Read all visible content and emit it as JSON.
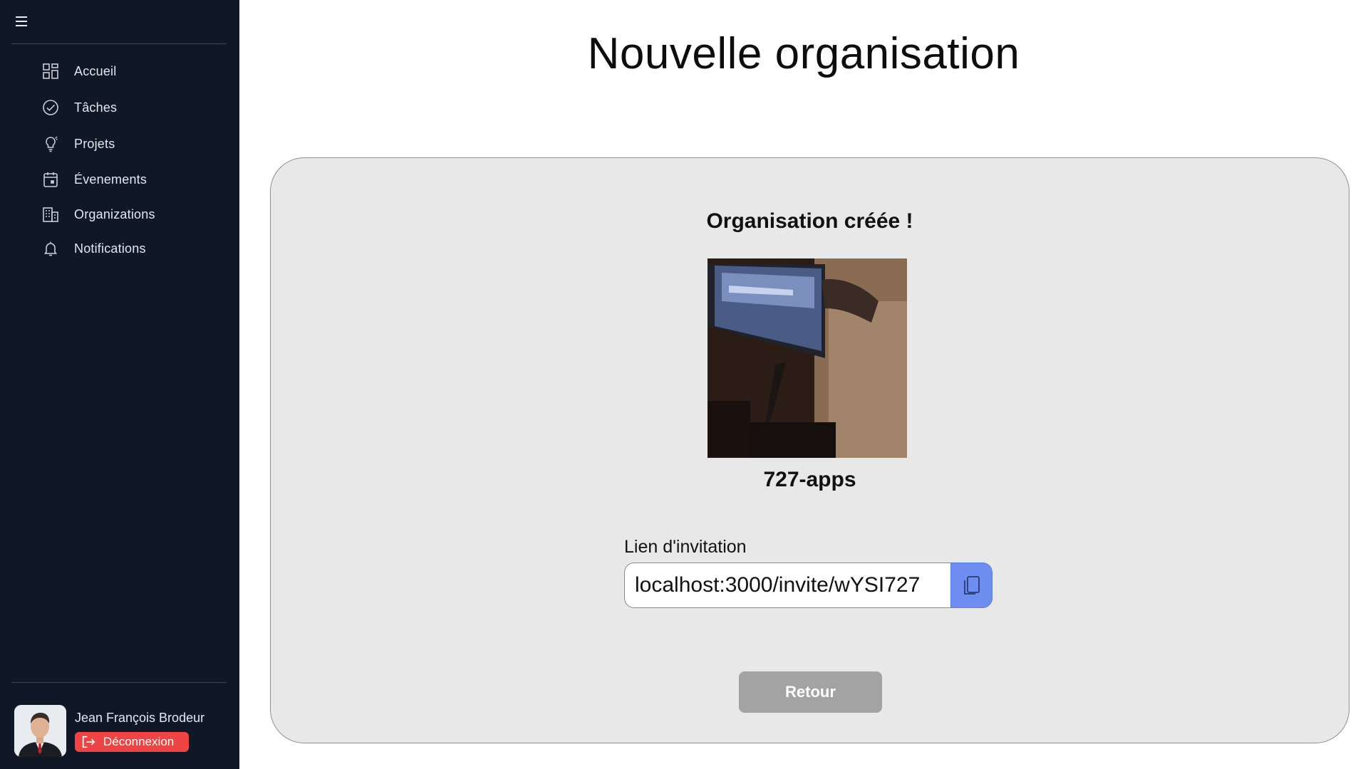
{
  "sidebar": {
    "menu_icon": "hamburger-icon",
    "items": [
      {
        "label": "Accueil",
        "icon": "dashboard-grid-icon"
      },
      {
        "label": "Tâches",
        "icon": "check-circle-icon"
      },
      {
        "label": "Projets",
        "icon": "lightbulb-icon"
      },
      {
        "label": "Évenements",
        "icon": "calendar-icon"
      },
      {
        "label": "Organizations",
        "icon": "building-icon"
      },
      {
        "label": "Notifications",
        "icon": "bell-icon"
      }
    ],
    "user": {
      "name": "Jean François Brodeur",
      "logout_label": "Déconnexion",
      "logout_icon": "logout-icon"
    }
  },
  "main": {
    "title": "Nouvelle organisation",
    "card": {
      "created_title": "Organisation créée !",
      "org_name": "727-apps",
      "invite_label": "Lien d'invitation",
      "invite_value": "localhost:3000/invite/wYSI727",
      "copy_icon": "copy-icon",
      "back_label": "Retour"
    }
  },
  "colors": {
    "sidebar_bg": "#101828",
    "logout_bg": "#f04444",
    "card_bg": "#e8e8e8",
    "copy_button": "#6d8ef0",
    "back_button": "#a3a3a3"
  }
}
